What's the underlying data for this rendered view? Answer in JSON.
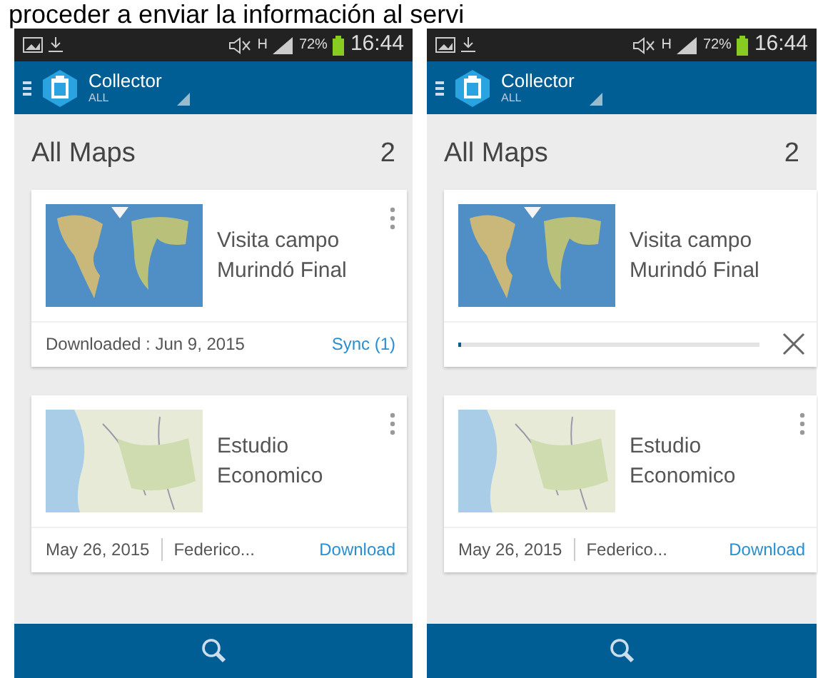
{
  "caption": "proceder a enviar la información al servi",
  "screens": [
    {
      "status_bar": {
        "network": "H",
        "battery": "72%",
        "time": "16:44"
      },
      "app_bar": {
        "title": "Collector",
        "subtitle": "ALL"
      },
      "heading": "All Maps",
      "count": "2",
      "maps": [
        {
          "title": "Visita campo Murindó Final",
          "menu": true,
          "footer": {
            "kind": "downloaded",
            "text": "Downloaded :  Jun 9, 2015",
            "action": "Sync (1)"
          }
        },
        {
          "title": "Estudio Economico",
          "menu": true,
          "footer": {
            "kind": "info",
            "date": "May 26, 2015",
            "owner": "Federico...",
            "action": "Download"
          }
        }
      ]
    },
    {
      "status_bar": {
        "network": "H",
        "battery": "72%",
        "time": "16:44"
      },
      "app_bar": {
        "title": "Collector",
        "subtitle": "ALL"
      },
      "heading": "All Maps",
      "count": "2",
      "maps": [
        {
          "title": "Visita campo Murindó Final",
          "menu": false,
          "footer": {
            "kind": "progress",
            "level": 0.01
          }
        },
        {
          "title": "Estudio Economico",
          "menu": true,
          "footer": {
            "kind": "info",
            "date": "May 26, 2015",
            "owner": "Federico...",
            "action": "Download"
          }
        }
      ]
    }
  ]
}
